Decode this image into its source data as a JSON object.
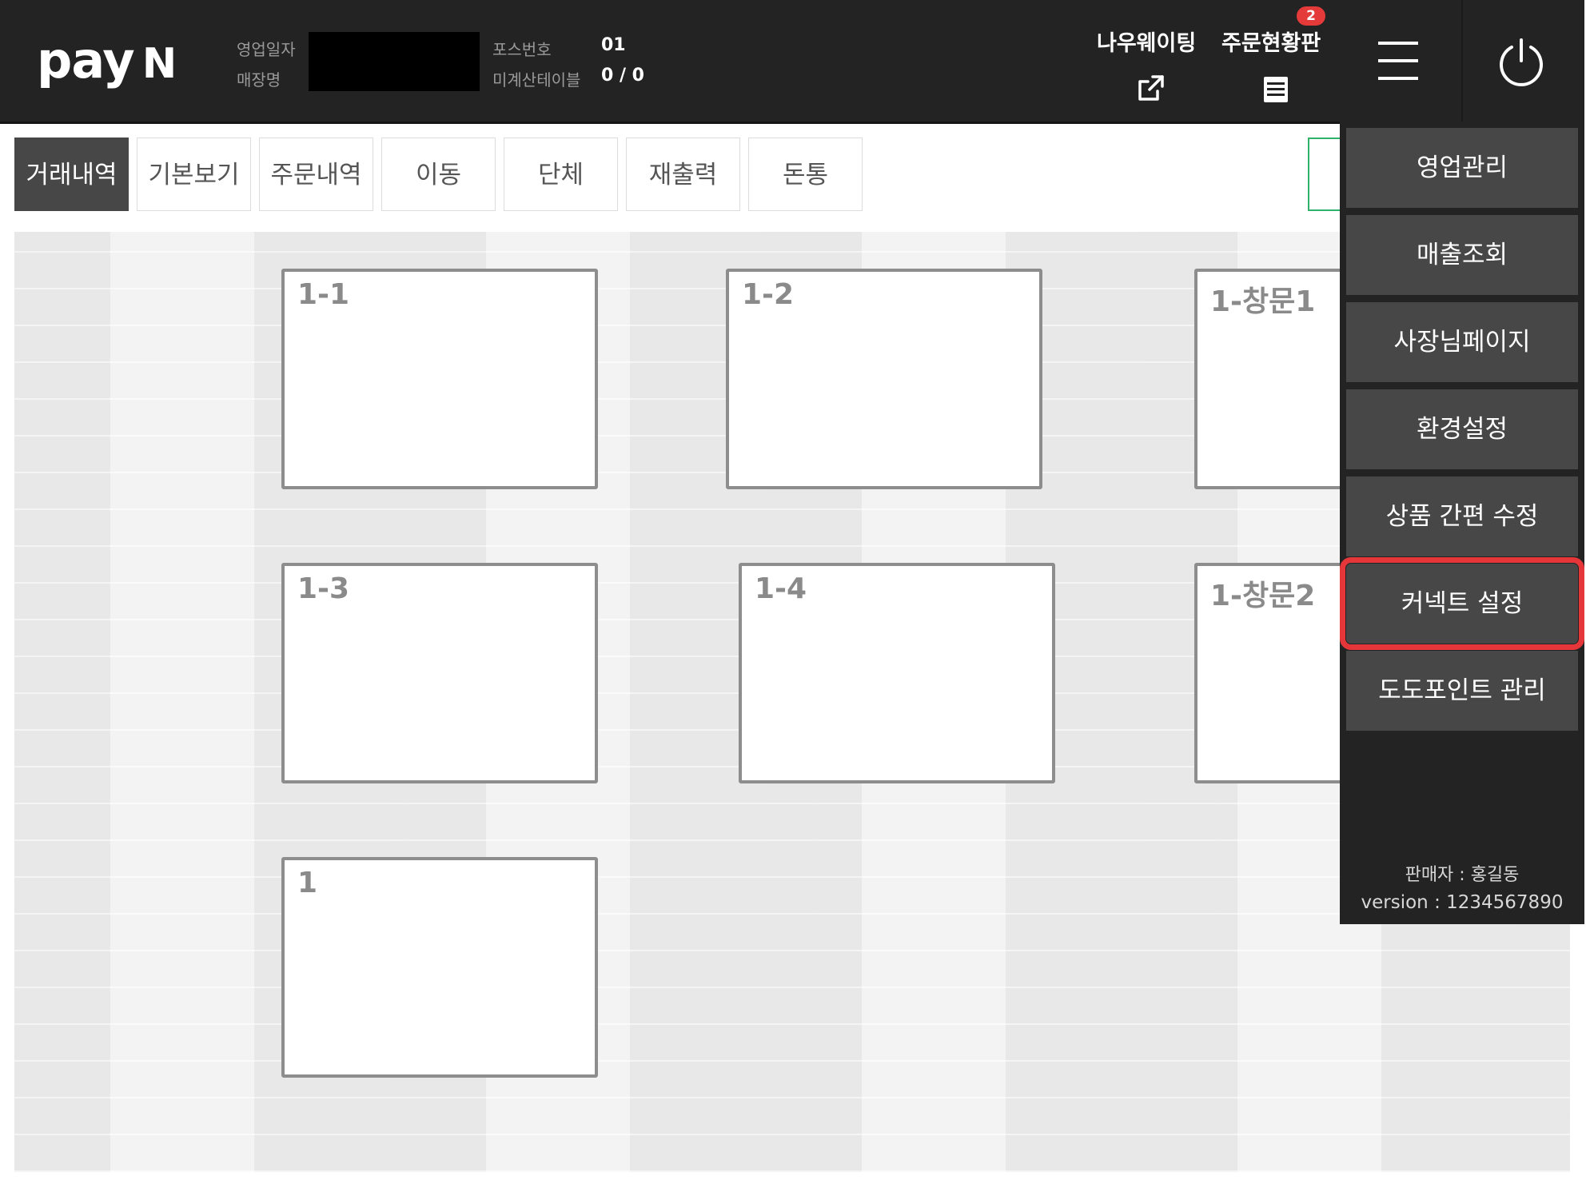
{
  "header": {
    "logo": "pay",
    "logo_n": "N",
    "business_date_label": "영업일자",
    "store_name_label": "매장명",
    "pos_number_label": "포스번호",
    "pos_number_value": "01",
    "unpaid_tables_label": "미계산테이블",
    "unpaid_tables_value": "0 / 0",
    "now_waiting_label": "나우웨이팅",
    "order_board_label": "주문현황판",
    "order_board_badge": "2",
    "icons": [
      "external-link-icon",
      "order-board-icon",
      "hamburger-icon",
      "power-icon"
    ]
  },
  "tabs": [
    {
      "label": "거래내역",
      "active": true
    },
    {
      "label": "기본보기",
      "active": false
    },
    {
      "label": "주문내역",
      "active": false
    },
    {
      "label": "이동",
      "active": false
    },
    {
      "label": "단체",
      "active": false
    },
    {
      "label": "재출력",
      "active": false
    },
    {
      "label": "돈통",
      "active": false
    }
  ],
  "tables": [
    {
      "label": "1-1"
    },
    {
      "label": "1-2"
    },
    {
      "label": "1-창문1"
    },
    {
      "label": "1-3"
    },
    {
      "label": "1-4"
    },
    {
      "label": "1-창문2"
    },
    {
      "label": "1"
    }
  ],
  "side_menu": {
    "items": [
      {
        "label": "영업관리"
      },
      {
        "label": "매출조회"
      },
      {
        "label": "사장님페이지"
      },
      {
        "label": "환경설정"
      },
      {
        "label": "상품 간편 수정"
      },
      {
        "label": "커넥트 설정",
        "highlighted": true
      },
      {
        "label": "도도포인트 관리"
      }
    ],
    "seller": "판매자 : 홍길동",
    "version": "version : 1234567890"
  },
  "colors": {
    "header_bg": "#232323",
    "menu_button_bg": "#474747",
    "active_tab_bg": "#474747",
    "highlight_outline": "#e5373a",
    "badge": "#e53a3a",
    "accent_green": "#2fb26b"
  }
}
